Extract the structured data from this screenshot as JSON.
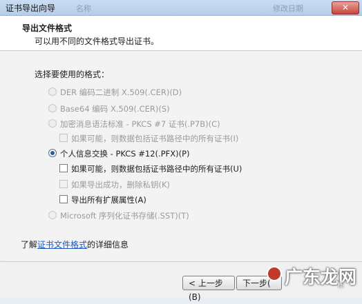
{
  "window": {
    "title": "证书导出向导",
    "close_label": "✕"
  },
  "background_columns": {
    "name": "名称",
    "date": "修改日期"
  },
  "header": {
    "title": "导出文件格式",
    "subtitle": "可以用不同的文件格式导出证书。"
  },
  "prompt": "选择要使用的格式：",
  "options": {
    "der": "DER 编码二进制 X.509(.CER)(D)",
    "base64": "Base64 编码 X.509(.CER)(S)",
    "pkcs7": "加密消息语法标准 - PKCS #7 证书(.P7B)(C)",
    "pkcs7_include": "如果可能，则数据包括证书路径中的所有证书(I)",
    "pfx": "个人信息交换 - PKCS #12(.PFX)(P)",
    "pfx_include": "如果可能，则数据包括证书路径中的所有证书(U)",
    "pfx_delete": "如果导出成功，删除私钥(K)",
    "pfx_extended": "导出所有扩展属性(A)",
    "sst": "Microsoft 序列化证书存储(.SST)(T)"
  },
  "more_info": {
    "prefix": "了解",
    "link": "证书文件格式",
    "suffix": "的详细信息"
  },
  "buttons": {
    "back": "< 上一步(B)",
    "next": "下一步("
  },
  "watermark": {
    "text": "广东龙网",
    "small": "标"
  }
}
